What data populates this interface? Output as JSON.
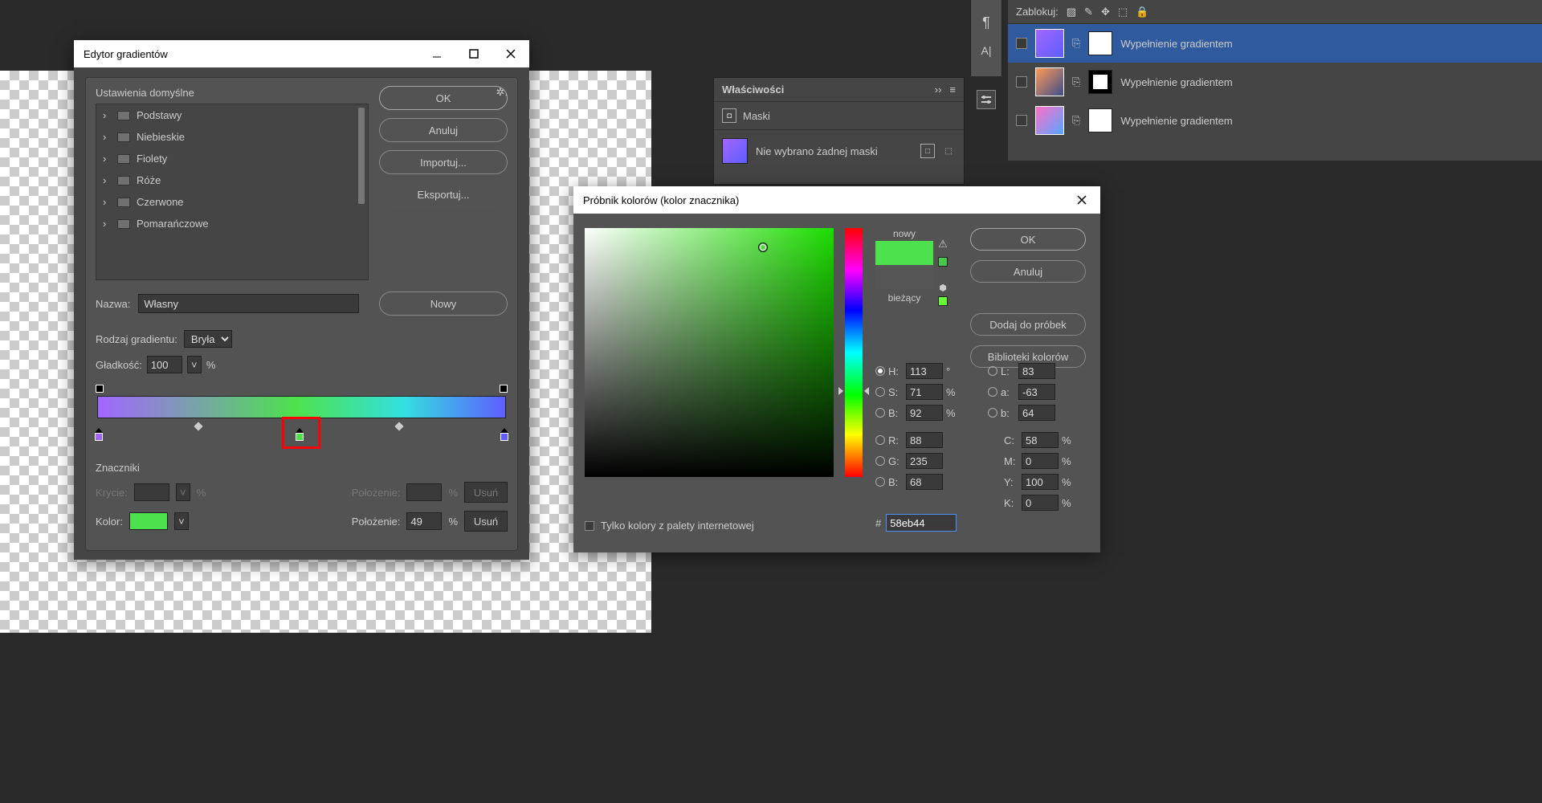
{
  "gradientEditor": {
    "title": "Edytor gradientów",
    "presetsHeader": "Ustawienia domyślne",
    "presetFolders": [
      "Podstawy",
      "Niebieskie",
      "Fiolety",
      "Róże",
      "Czerwone",
      "Pomarańczowe"
    ],
    "buttons": {
      "ok": "OK",
      "cancel": "Anuluj",
      "import": "Importuj...",
      "export": "Eksportuj...",
      "new": "Nowy"
    },
    "nameLabel": "Nazwa:",
    "nameValue": "Własny",
    "typeLabel": "Rodzaj gradientu:",
    "typeValue": "Bryła",
    "smoothLabel": "Gładkość:",
    "smoothValue": "100",
    "pct": "%",
    "stopsHeader": "Znaczniki",
    "opacityLabel": "Krycie:",
    "positionLabel": "Położenie:",
    "deleteLabel": "Usuń",
    "colorLabel": "Kolor:",
    "positionValue": "49",
    "stopColor": "#4de24d"
  },
  "colorPicker": {
    "title": "Próbnik kolorów (kolor znacznika)",
    "buttons": {
      "ok": "OK",
      "cancel": "Anuluj",
      "add": "Dodaj do próbek",
      "libs": "Biblioteki kolorów"
    },
    "newLabel": "nowy",
    "currentLabel": "bieżący",
    "H": {
      "label": "H:",
      "value": "113",
      "unit": "°"
    },
    "S": {
      "label": "S:",
      "value": "71",
      "unit": "%"
    },
    "Bh": {
      "label": "B:",
      "value": "92",
      "unit": "%"
    },
    "R": {
      "label": "R:",
      "value": "88"
    },
    "G": {
      "label": "G:",
      "value": "235"
    },
    "Bl": {
      "label": "B:",
      "value": "68"
    },
    "L": {
      "label": "L:",
      "value": "83"
    },
    "a": {
      "label": "a:",
      "value": "-63"
    },
    "b": {
      "label": "b:",
      "value": "64"
    },
    "C": {
      "label": "C:",
      "value": "58",
      "unit": "%"
    },
    "M": {
      "label": "M:",
      "value": "0",
      "unit": "%"
    },
    "Y": {
      "label": "Y:",
      "value": "100",
      "unit": "%"
    },
    "K": {
      "label": "K:",
      "value": "0",
      "unit": "%"
    },
    "hexLabel": "#",
    "hexValue": "58eb44",
    "webOnly": "Tylko kolory z palety internetowej"
  },
  "properties": {
    "title": "Właściwości",
    "masks": "Maski",
    "noMask": "Nie wybrano żadnej maski"
  },
  "layers": {
    "lockLabel": "Zablokuj:",
    "fillName": "Wypełnienie gradientem"
  }
}
